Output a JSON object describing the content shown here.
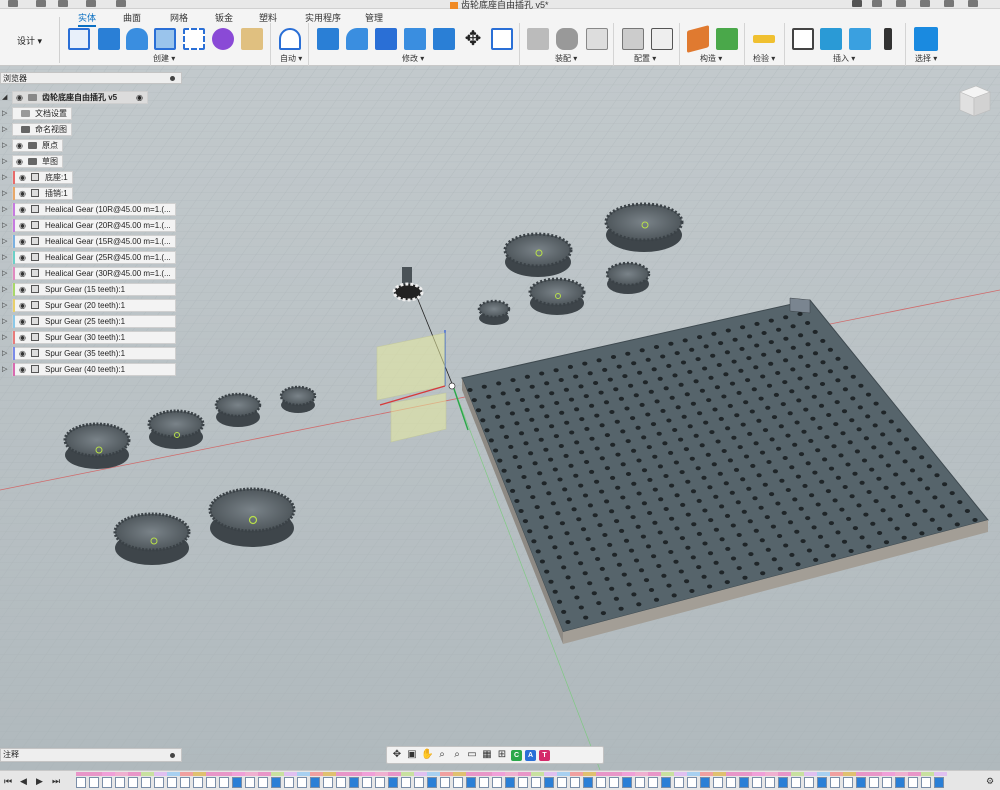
{
  "titlebar": {
    "doc_title": "齿轮底座自由插孔 v5*"
  },
  "ribbon": {
    "design_button": "设计 ▾",
    "tabs": [
      "实体",
      "曲面",
      "网格",
      "钣金",
      "塑料",
      "实用程序",
      "管理"
    ],
    "groups": {
      "create": "创建 ▾",
      "auto": "自动 ▾",
      "modify": "修改 ▾",
      "assemble": "装配 ▾",
      "configure": "配置 ▾",
      "construct": "构造 ▾",
      "inspect": "检验 ▾",
      "insert": "插入 ▾",
      "select": "选择 ▾"
    }
  },
  "browser": {
    "header": "浏览器",
    "root": "齿轮底座自由插孔 v5",
    "items": [
      {
        "label": "文档设置",
        "type": "settings"
      },
      {
        "label": "命名视图",
        "type": "folder"
      },
      {
        "label": "原点",
        "type": "folder"
      },
      {
        "label": "草图",
        "type": "folder"
      },
      {
        "label": "底座:1",
        "type": "component",
        "color": "#e86a6a"
      },
      {
        "label": "插销:1",
        "type": "component",
        "color": "#e8a86a"
      },
      {
        "label": "Healical Gear (10R@45.00 m=1.(...",
        "type": "component",
        "color": "#c57ae0"
      },
      {
        "label": "Healical Gear (20R@45.00 m=1.(...",
        "type": "component",
        "color": "#c57ae0"
      },
      {
        "label": "Healical Gear (15R@45.00 m=1.(...",
        "type": "component",
        "color": "#7ab0e0"
      },
      {
        "label": "Healical Gear (25R@45.00 m=1.(...",
        "type": "component",
        "color": "#6ad0c8"
      },
      {
        "label": "Healical Gear (30R@45.00 m=1.(...",
        "type": "component",
        "color": "#e08ac0"
      },
      {
        "label": "Spur Gear (15 teeth):1",
        "type": "component",
        "color": "#a8d86a"
      },
      {
        "label": "Spur Gear (20 teeth):1",
        "type": "component",
        "color": "#e8d06a"
      },
      {
        "label": "Spur Gear (25 teeth):1",
        "type": "component",
        "color": "#8ac8e8"
      },
      {
        "label": "Spur Gear (30 teeth):1",
        "type": "component",
        "color": "#e87a7a"
      },
      {
        "label": "Spur Gear (35 teeth):1",
        "type": "component",
        "color": "#7a8ae8"
      },
      {
        "label": "Spur Gear (40 teeth):1",
        "type": "component",
        "color": "#d86ab0"
      }
    ]
  },
  "comments": {
    "label": "注释"
  },
  "navbar": {
    "icons": [
      "orbit-icon",
      "pan-icon",
      "hand-icon",
      "zoom-icon",
      "zoom-window-icon",
      "display-icon",
      "grid-icon",
      "viewports-icon"
    ],
    "badges": [
      "C",
      "A",
      "T"
    ],
    "badge_colors": [
      "#2aa84a",
      "#2a6fd6",
      "#d42a6a"
    ]
  },
  "colors": {
    "accent": "#0a6fc2",
    "viewport_bg": "#b4bdc1",
    "plate": "#56646b"
  }
}
